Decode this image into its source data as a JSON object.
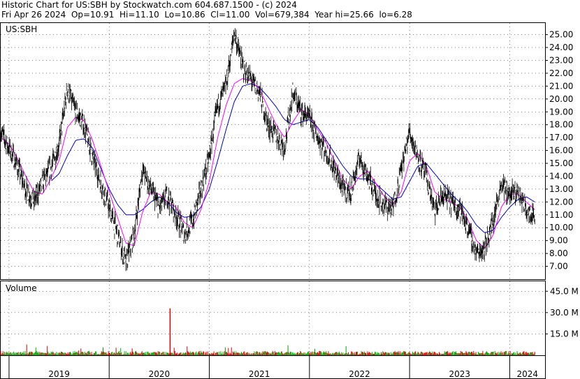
{
  "header": {
    "line1": "Historic Chart for US:SBH by Stockwatch.com 604.687.1500 - (c) 2024",
    "line2": "Fri Apr 26 2024  Op=10.91  Hi=11.10  Lo=10.86  Cl=11.00  Vol=679,384  Year hi=25.66  lo=6.28"
  },
  "price_panel": {
    "label": "US:SBH"
  },
  "volume_panel": {
    "label": "Volume"
  },
  "colors": {
    "price": "#000000",
    "ma_short": "#ff00ff",
    "ma_long": "#0000cc",
    "vol_up": "#00aa00",
    "vol_down": "#dd0000",
    "grid": "#000000"
  },
  "chart_data": [
    {
      "type": "line",
      "title": "US:SBH",
      "ylim": [
        6.0,
        25.9
      ],
      "y_ticks": [
        "7.00",
        "8.00",
        "9.00",
        "10.00",
        "11.00",
        "12.00",
        "13.00",
        "14.00",
        "15.00",
        "16.00",
        "17.00",
        "18.00",
        "19.00",
        "20.00",
        "21.00",
        "22.00",
        "23.00",
        "24.00",
        "25.00"
      ],
      "x_labels": [
        "2019",
        "2020",
        "2021",
        "2022",
        "2023",
        "2024"
      ],
      "series": [
        {
          "role": "price",
          "x": [
            "2018-12",
            "2019-01",
            "2019-02",
            "2019-03",
            "2019-04",
            "2019-05",
            "2019-06",
            "2019-07",
            "2019-08",
            "2019-09",
            "2019-10",
            "2019-11",
            "2019-12",
            "2020-01",
            "2020-02",
            "2020-03",
            "2020-04",
            "2020-05",
            "2020-06",
            "2020-07",
            "2020-08",
            "2020-09",
            "2020-10",
            "2020-11",
            "2020-12",
            "2021-01",
            "2021-02",
            "2021-03",
            "2021-04",
            "2021-05",
            "2021-06",
            "2021-07",
            "2021-08",
            "2021-09",
            "2021-10",
            "2021-11",
            "2021-12",
            "2022-01",
            "2022-02",
            "2022-03",
            "2022-04",
            "2022-05",
            "2022-06",
            "2022-07",
            "2022-08",
            "2022-09",
            "2022-10",
            "2022-11",
            "2022-12",
            "2023-01",
            "2023-02",
            "2023-03",
            "2023-04",
            "2023-05",
            "2023-06",
            "2023-07",
            "2023-08",
            "2023-09",
            "2023-10",
            "2023-11",
            "2023-12",
            "2024-01",
            "2024-02",
            "2024-03",
            "2024-04"
          ],
          "values": [
            17.5,
            16.2,
            14.8,
            13.0,
            12.0,
            13.5,
            14.6,
            16.5,
            20.8,
            19.0,
            18.0,
            15.5,
            13.5,
            11.5,
            9.5,
            7.2,
            9.5,
            14.5,
            13.0,
            11.5,
            12.5,
            11.0,
            9.5,
            10.5,
            13.0,
            15.5,
            19.5,
            21.0,
            25.2,
            22.5,
            21.5,
            20.5,
            18.0,
            17.2,
            16.2,
            20.5,
            19.0,
            18.5,
            17.0,
            16.0,
            14.5,
            13.0,
            12.8,
            15.5,
            14.0,
            12.5,
            11.8,
            11.5,
            14.5,
            17.5,
            15.5,
            14.0,
            11.2,
            12.5,
            12.0,
            11.5,
            10.0,
            8.0,
            8.5,
            10.5,
            13.5,
            12.5,
            12.8,
            11.5,
            11.0
          ]
        },
        {
          "role": "ma_short",
          "x": [
            "2018-12",
            "2019-01",
            "2019-02",
            "2019-03",
            "2019-04",
            "2019-05",
            "2019-06",
            "2019-07",
            "2019-08",
            "2019-09",
            "2019-10",
            "2019-11",
            "2019-12",
            "2020-01",
            "2020-02",
            "2020-03",
            "2020-04",
            "2020-05",
            "2020-06",
            "2020-07",
            "2020-08",
            "2020-09",
            "2020-10",
            "2020-11",
            "2020-12",
            "2021-01",
            "2021-02",
            "2021-03",
            "2021-04",
            "2021-05",
            "2021-06",
            "2021-07",
            "2021-08",
            "2021-09",
            "2021-10",
            "2021-11",
            "2021-12",
            "2022-01",
            "2022-02",
            "2022-03",
            "2022-04",
            "2022-05",
            "2022-06",
            "2022-07",
            "2022-08",
            "2022-09",
            "2022-10",
            "2022-11",
            "2022-12",
            "2023-01",
            "2023-02",
            "2023-03",
            "2023-04",
            "2023-05",
            "2023-06",
            "2023-07",
            "2023-08",
            "2023-09",
            "2023-10",
            "2023-11",
            "2023-12",
            "2024-01",
            "2024-02",
            "2024-03",
            "2024-04"
          ],
          "values": [
            17.0,
            16.5,
            15.4,
            14.0,
            12.8,
            12.6,
            13.8,
            15.2,
            17.8,
            18.6,
            18.3,
            16.8,
            14.8,
            12.8,
            10.8,
            8.8,
            8.6,
            11.2,
            12.8,
            12.6,
            12.0,
            11.6,
            10.4,
            10.0,
            11.4,
            13.6,
            17.0,
            19.5,
            21.2,
            21.6,
            21.4,
            20.8,
            19.4,
            18.0,
            17.0,
            18.2,
            19.2,
            18.8,
            17.6,
            16.6,
            15.2,
            13.8,
            13.0,
            14.0,
            14.4,
            13.4,
            12.4,
            11.8,
            12.8,
            15.2,
            15.8,
            14.8,
            12.8,
            12.2,
            12.0,
            11.6,
            10.6,
            9.0,
            8.4,
            9.4,
            11.6,
            12.6,
            12.6,
            12.0,
            11.4
          ]
        },
        {
          "role": "ma_long",
          "x": [
            "2018-12",
            "2019-01",
            "2019-02",
            "2019-03",
            "2019-04",
            "2019-05",
            "2019-06",
            "2019-07",
            "2019-08",
            "2019-09",
            "2019-10",
            "2019-11",
            "2019-12",
            "2020-01",
            "2020-02",
            "2020-03",
            "2020-04",
            "2020-05",
            "2020-06",
            "2020-07",
            "2020-08",
            "2020-09",
            "2020-10",
            "2020-11",
            "2020-12",
            "2021-01",
            "2021-02",
            "2021-03",
            "2021-04",
            "2021-05",
            "2021-06",
            "2021-07",
            "2021-08",
            "2021-09",
            "2021-10",
            "2021-11",
            "2021-12",
            "2022-01",
            "2022-02",
            "2022-03",
            "2022-04",
            "2022-05",
            "2022-06",
            "2022-07",
            "2022-08",
            "2022-09",
            "2022-10",
            "2022-11",
            "2022-12",
            "2023-01",
            "2023-02",
            "2023-03",
            "2023-04",
            "2023-05",
            "2023-06",
            "2023-07",
            "2023-08",
            "2023-09",
            "2023-10",
            "2023-11",
            "2023-12",
            "2024-01",
            "2024-02",
            "2024-03",
            "2024-04"
          ],
          "values": [
            null,
            null,
            null,
            null,
            null,
            null,
            13.6,
            14.2,
            15.6,
            16.8,
            16.9,
            16.2,
            14.6,
            13.0,
            11.8,
            11.0,
            11.0,
            11.4,
            12.0,
            12.4,
            12.0,
            11.2,
            10.8,
            10.9,
            11.6,
            13.0,
            15.2,
            17.6,
            19.8,
            21.0,
            21.2,
            20.9,
            20.2,
            19.4,
            18.4,
            18.0,
            18.2,
            18.4,
            17.8,
            16.8,
            15.8,
            14.8,
            14.0,
            13.8,
            13.8,
            13.4,
            12.8,
            12.2,
            12.4,
            13.6,
            14.8,
            15.0,
            14.2,
            13.4,
            12.6,
            12.0,
            11.2,
            10.2,
            9.6,
            9.8,
            10.8,
            11.6,
            12.2,
            12.4,
            12.0
          ]
        }
      ]
    },
    {
      "type": "bar",
      "title": "Volume",
      "ylim": [
        0,
        52
      ],
      "y_ticks": [
        "15.0 M",
        "30.0 M",
        "45.0 M"
      ],
      "y_unit": "M",
      "spike": {
        "x": "2020-08",
        "value": 33.0
      },
      "typical_range": [
        0.5,
        3.0
      ]
    }
  ]
}
